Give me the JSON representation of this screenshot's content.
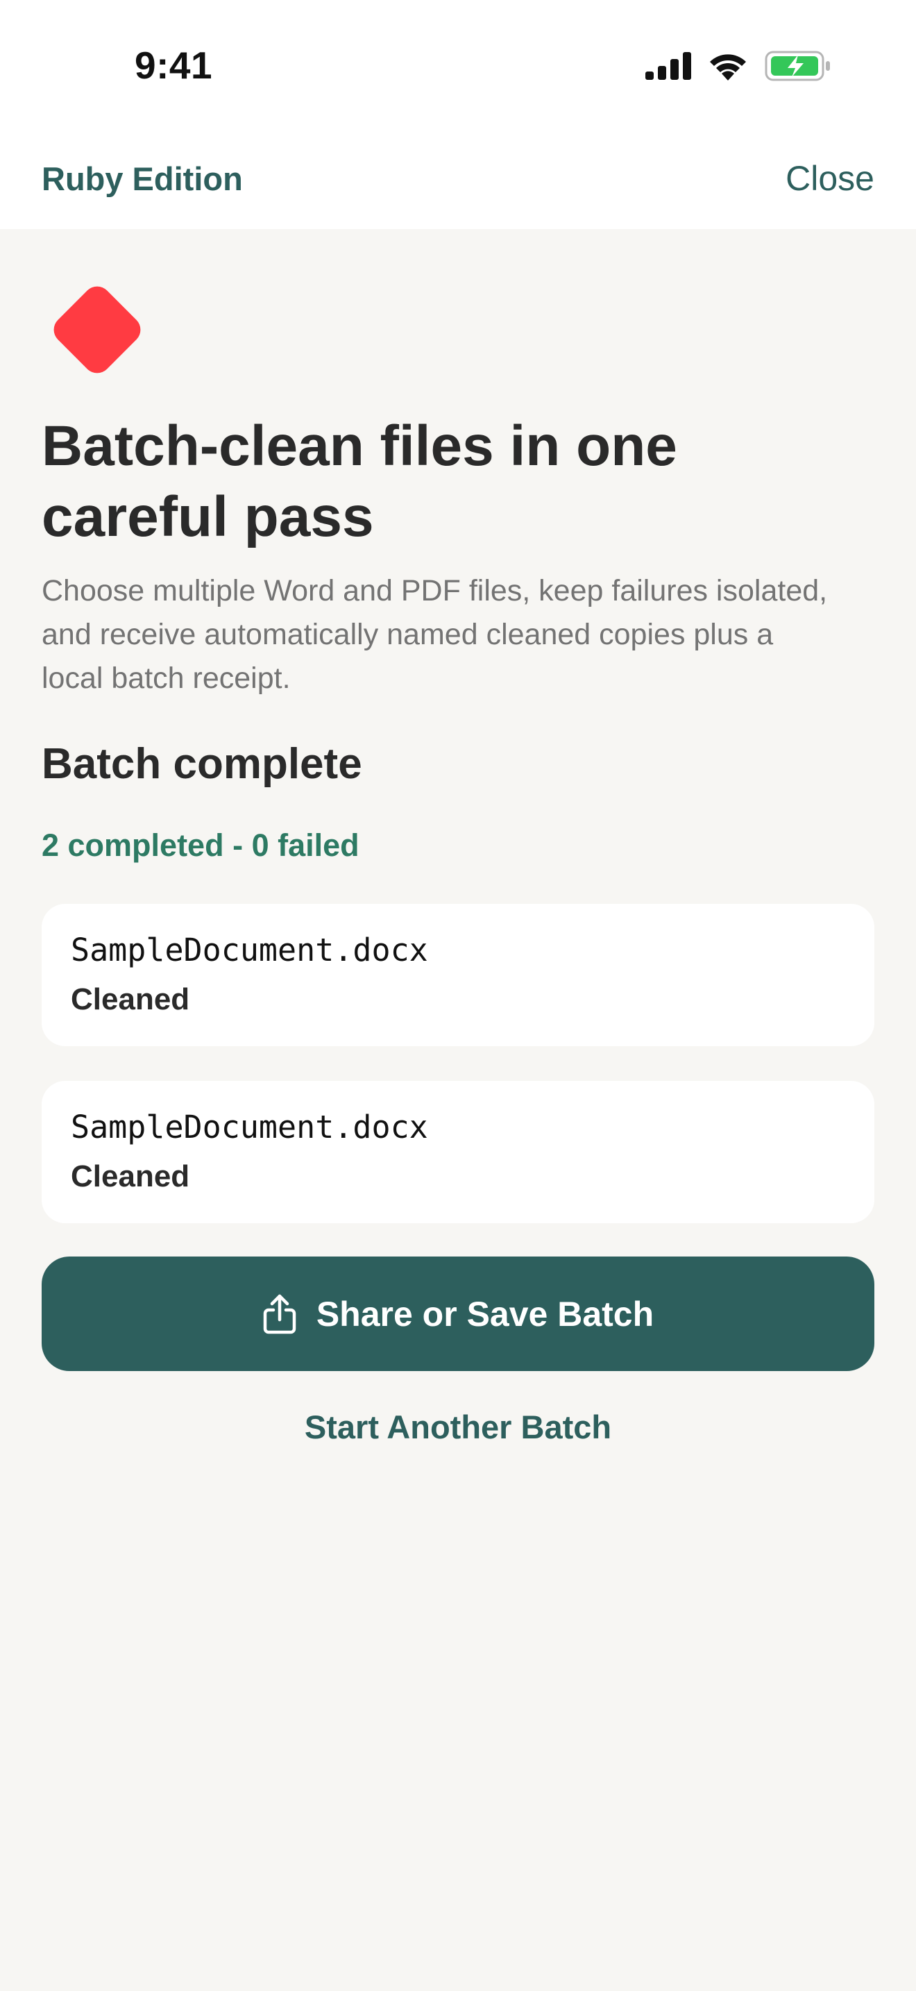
{
  "status_bar": {
    "time": "9:41",
    "icons": [
      "cellular-signal-icon",
      "wifi-icon",
      "battery-charging-icon"
    ]
  },
  "nav": {
    "edition_label": "Ruby Edition",
    "close_label": "Close"
  },
  "hero": {
    "icon": "red-diamond-icon",
    "title": "Batch-clean files in one careful pass",
    "description": "Choose multiple Word and PDF files, keep failures isolated, and receive automatically named cleaned copies plus a local batch receipt."
  },
  "batch": {
    "section_title": "Batch complete",
    "summary": "2 completed - 0 failed",
    "files": [
      {
        "name": "SampleDocument.docx",
        "status": "Cleaned"
      },
      {
        "name": "SampleDocument.docx",
        "status": "Cleaned"
      }
    ]
  },
  "actions": {
    "primary_label": "Share or Save Batch",
    "primary_icon": "share-icon",
    "secondary_label": "Start Another Batch"
  },
  "colors": {
    "accent": "#2d5f5d",
    "success": "#2d7a63",
    "brand_red": "#ff3b42",
    "background": "#f7f6f3",
    "card": "#ffffff"
  }
}
